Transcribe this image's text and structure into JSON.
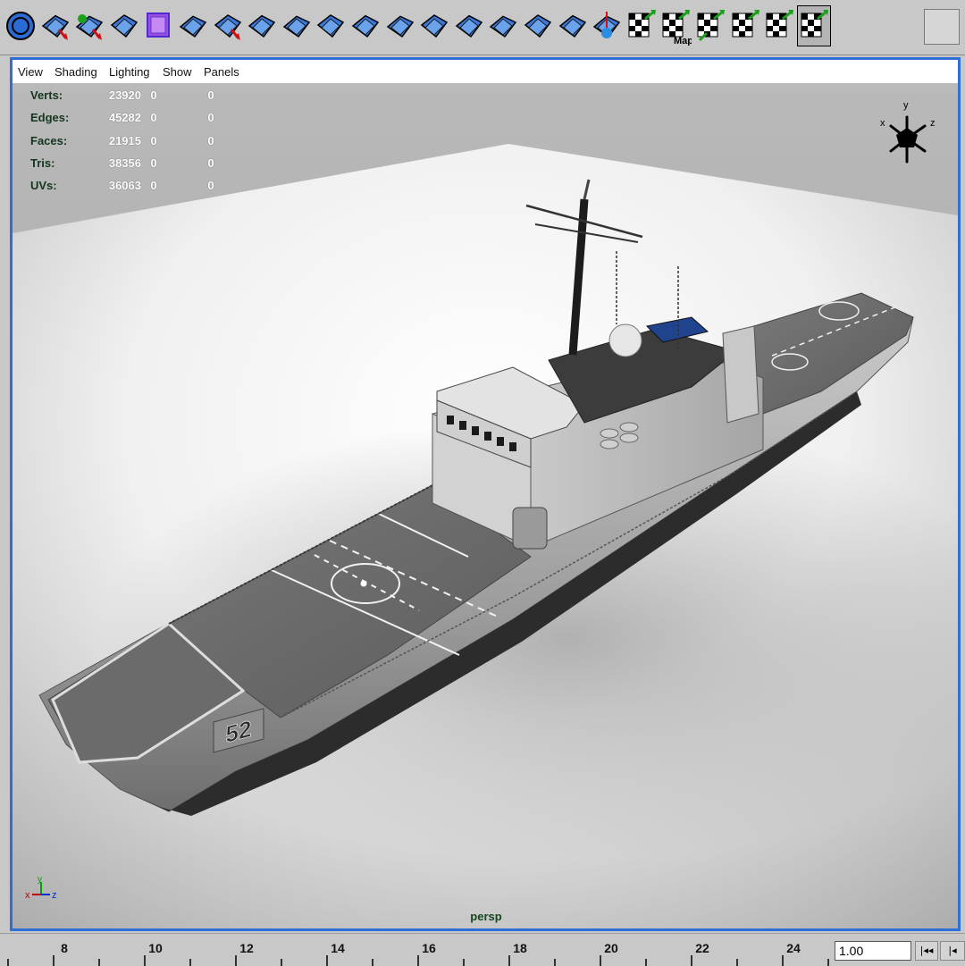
{
  "shelf": {
    "tools": [
      "poly-sphere-icon",
      "extract-faces-icon",
      "combine-icon",
      "separate-icon",
      "smooth-cube-icon",
      "split-polygon-icon",
      "cut-faces-icon",
      "extrude-face-icon",
      "extrude-edge-icon",
      "append-polygon-icon",
      "bevel-icon",
      "merge-vertices-icon",
      "collapse-icon",
      "split-edge-icon",
      "wedge-face-icon",
      "poke-face-icon",
      "duplicate-face-icon",
      "sculpt-icon",
      "planar-map-icon",
      "automatic-map-icon",
      "cylindrical-map-icon",
      "spherical-map-icon",
      "texture-editor-icon",
      "uv-snapshot-icon"
    ],
    "map_label": "Map",
    "selected_index": 23
  },
  "panel_menu": [
    "View",
    "Shading",
    "Lighting",
    "Show",
    "Panels"
  ],
  "hud": [
    {
      "label": "Verts:",
      "total": "23920",
      "c1": "0",
      "c2": "0"
    },
    {
      "label": "Edges:",
      "total": "45282",
      "c1": "0",
      "c2": "0"
    },
    {
      "label": "Faces:",
      "total": "21915",
      "c1": "0",
      "c2": "0"
    },
    {
      "label": "Tris:",
      "total": "38356",
      "c1": "0",
      "c2": "0"
    },
    {
      "label": "UVs:",
      "total": "36063",
      "c1": "0",
      "c2": "0"
    }
  ],
  "view_cube_axes": {
    "x": "x",
    "y": "y",
    "z": "z"
  },
  "origin_axes": {
    "x": "x",
    "y": "y",
    "z": "z"
  },
  "camera": "persp",
  "hull_number": "52",
  "timeline": {
    "ticks": [
      "8",
      "10",
      "12",
      "14",
      "16",
      "18",
      "20",
      "22",
      "24"
    ],
    "current_time": "1.00",
    "rewind_label": "|◂◂",
    "step_back_label": "|◂"
  },
  "colors": {
    "panel_border": "#2e6ed8",
    "ui_gray": "#c8c8c8",
    "hud_label": "#14361e",
    "camera_label": "#154620"
  }
}
